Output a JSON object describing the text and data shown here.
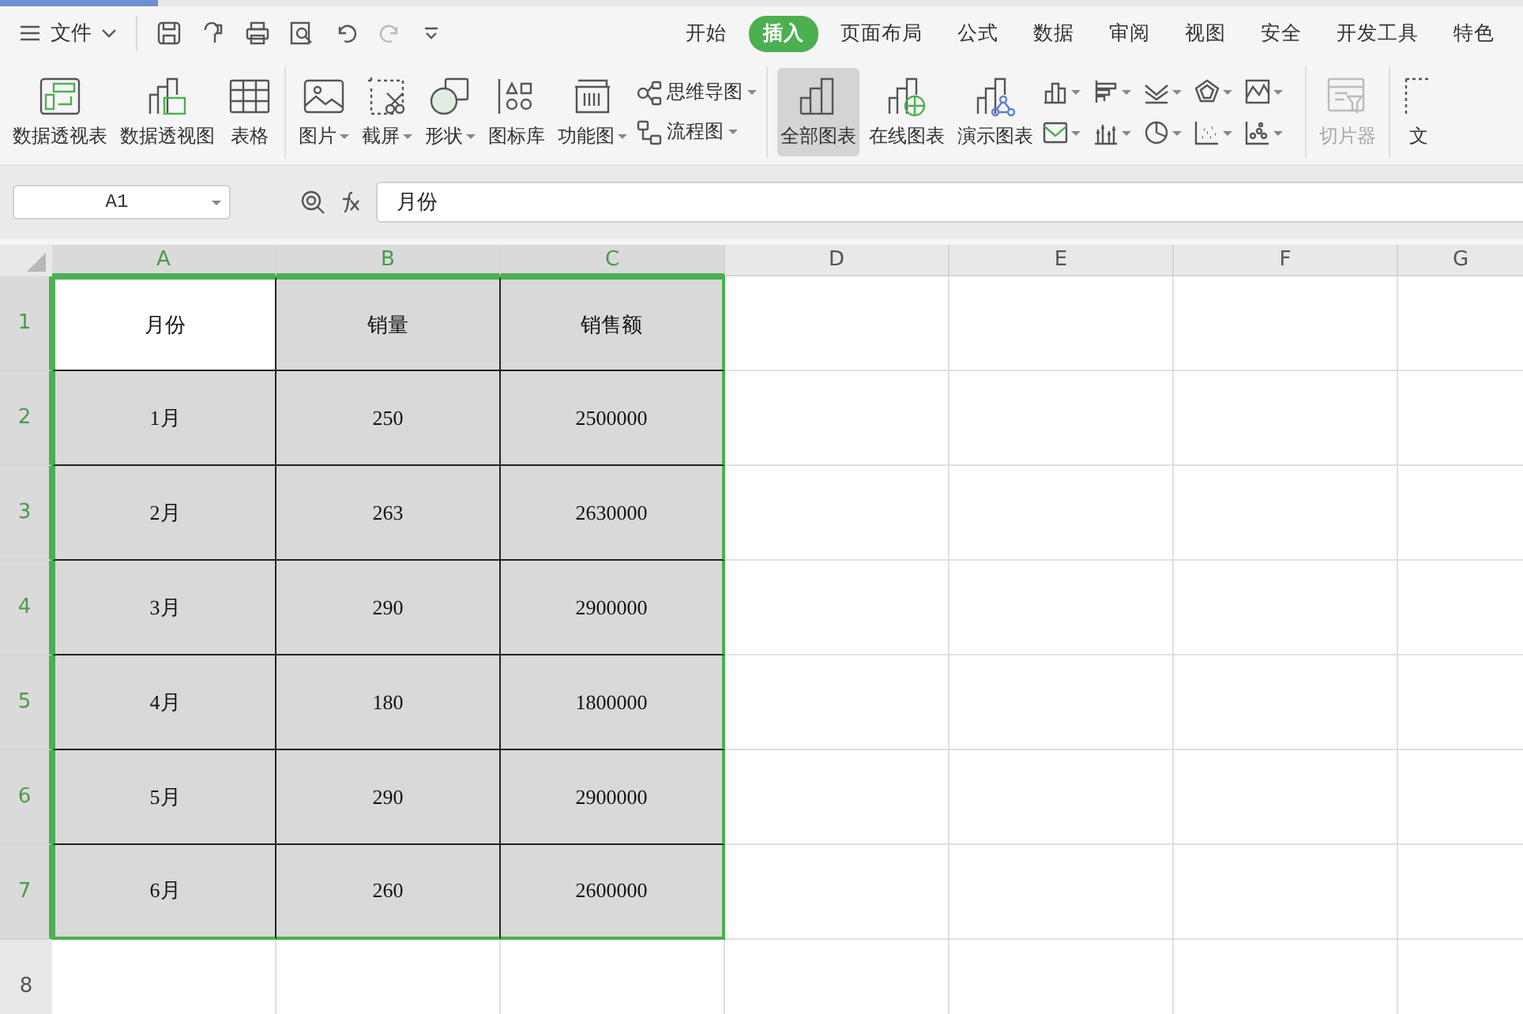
{
  "menu": {
    "label": "文件"
  },
  "tabs": [
    {
      "label": "开始",
      "selected": false
    },
    {
      "label": "插入",
      "selected": true
    },
    {
      "label": "页面布局",
      "selected": false
    },
    {
      "label": "公式",
      "selected": false
    },
    {
      "label": "数据",
      "selected": false
    },
    {
      "label": "审阅",
      "selected": false
    },
    {
      "label": "视图",
      "selected": false
    },
    {
      "label": "安全",
      "selected": false
    },
    {
      "label": "开发工具",
      "selected": false
    },
    {
      "label": "特色",
      "selected": false
    }
  ],
  "ribbon": [
    {
      "kind": "large",
      "label": "数据透视表",
      "dropdown": false,
      "selected": false,
      "disabled": false
    },
    {
      "kind": "large",
      "label": "数据透视图",
      "dropdown": false,
      "selected": false,
      "disabled": false
    },
    {
      "kind": "large",
      "label": "表格",
      "dropdown": false,
      "selected": false,
      "disabled": false
    },
    {
      "kind": "separator"
    },
    {
      "kind": "large",
      "label": "图片",
      "dropdown": true,
      "selected": false,
      "disabled": false
    },
    {
      "kind": "large",
      "label": "截屏",
      "dropdown": true,
      "selected": false,
      "disabled": false
    },
    {
      "kind": "large",
      "label": "形状",
      "dropdown": true,
      "selected": false,
      "disabled": false
    },
    {
      "kind": "large",
      "label": "图标库",
      "dropdown": false,
      "selected": false,
      "disabled": false
    },
    {
      "kind": "large",
      "label": "功能图",
      "dropdown": true,
      "selected": false,
      "disabled": false
    },
    {
      "kind": "small_pair",
      "items": [
        {
          "label": "思维导图",
          "dropdown": true
        },
        {
          "label": "流程图",
          "dropdown": true
        }
      ]
    },
    {
      "kind": "separator"
    },
    {
      "kind": "large",
      "label": "全部图表",
      "dropdown": false,
      "selected": true,
      "disabled": false
    },
    {
      "kind": "large",
      "label": "在线图表",
      "dropdown": false,
      "selected": false,
      "disabled": false
    },
    {
      "kind": "large",
      "label": "演示图表",
      "dropdown": false,
      "selected": false,
      "disabled": false
    },
    {
      "kind": "icon_grid"
    },
    {
      "kind": "separator"
    },
    {
      "kind": "large",
      "label": "切片器",
      "dropdown": false,
      "selected": false,
      "disabled": true
    },
    {
      "kind": "separator"
    },
    {
      "kind": "large",
      "label": "文",
      "dropdown": false,
      "selected": false,
      "disabled": false
    }
  ],
  "formula_bar": {
    "name_box": "A1",
    "formula": "月份"
  },
  "sheet": {
    "columns": [
      {
        "label": "A",
        "selected": true
      },
      {
        "label": "B",
        "selected": true
      },
      {
        "label": "C",
        "selected": true
      },
      {
        "label": "D",
        "selected": false
      },
      {
        "label": "E",
        "selected": false
      },
      {
        "label": "F",
        "selected": false
      },
      {
        "label": "G",
        "selected": false
      }
    ],
    "rows": [
      {
        "header": "1",
        "selected": true,
        "cells": [
          {
            "text": "月份",
            "active": true
          },
          {
            "text": "销量",
            "active": false
          },
          {
            "text": "销售额",
            "active": false
          }
        ]
      },
      {
        "header": "2",
        "selected": true,
        "cells": [
          {
            "text": "1月",
            "active": false
          },
          {
            "text": "250",
            "active": false
          },
          {
            "text": "2500000",
            "active": false
          }
        ]
      },
      {
        "header": "3",
        "selected": true,
        "cells": [
          {
            "text": "2月",
            "active": false
          },
          {
            "text": "263",
            "active": false
          },
          {
            "text": "2630000",
            "active": false
          }
        ]
      },
      {
        "header": "4",
        "selected": true,
        "cells": [
          {
            "text": "3月",
            "active": false
          },
          {
            "text": "290",
            "active": false
          },
          {
            "text": "2900000",
            "active": false
          }
        ]
      },
      {
        "header": "5",
        "selected": true,
        "cells": [
          {
            "text": "4月",
            "active": false
          },
          {
            "text": "180",
            "active": false
          },
          {
            "text": "1800000",
            "active": false
          }
        ]
      },
      {
        "header": "6",
        "selected": true,
        "cells": [
          {
            "text": "5月",
            "active": false
          },
          {
            "text": "290",
            "active": false
          },
          {
            "text": "2900000",
            "active": false
          }
        ]
      },
      {
        "header": "7",
        "selected": true,
        "cells": [
          {
            "text": "6月",
            "active": false
          },
          {
            "text": "260",
            "active": false
          },
          {
            "text": "2600000",
            "active": false
          }
        ]
      },
      {
        "header": "8",
        "selected": false
      }
    ]
  }
}
